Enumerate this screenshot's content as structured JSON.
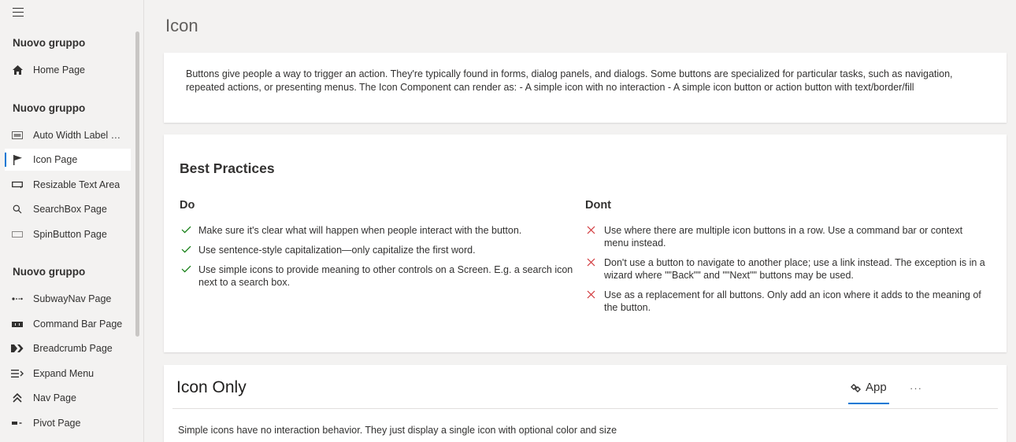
{
  "sidebar": {
    "groups": [
      {
        "title": "Nuovo gruppo",
        "items": [
          {
            "label": "Home Page",
            "icon": "home-icon"
          }
        ]
      },
      {
        "title": "Nuovo gruppo",
        "items": [
          {
            "label": "Auto Width Label Page",
            "icon": "label-icon"
          },
          {
            "label": "Icon Page",
            "icon": "flag-icon",
            "selected": true
          },
          {
            "label": "Resizable Text Area",
            "icon": "text-area-icon"
          },
          {
            "label": "SearchBox Page",
            "icon": "search-icon"
          },
          {
            "label": "SpinButton Page",
            "icon": "spin-button-icon"
          }
        ]
      },
      {
        "title": "Nuovo gruppo",
        "items": [
          {
            "label": "SubwayNav Page",
            "icon": "subway-nav-icon"
          },
          {
            "label": "Command Bar Page",
            "icon": "command-bar-icon"
          },
          {
            "label": "Breadcrumb Page",
            "icon": "breadcrumb-icon"
          },
          {
            "label": "Expand Menu",
            "icon": "expand-menu-icon"
          },
          {
            "label": "Nav Page",
            "icon": "nav-icon"
          },
          {
            "label": "Pivot Page",
            "icon": "pivot-icon"
          }
        ]
      }
    ]
  },
  "main": {
    "title": "Icon",
    "description": "Buttons give people a way to trigger an action. They're typically found in forms, dialog panels, and dialogs. Some buttons are specialized for particular tasks, such as navigation, repeated actions, or presenting menus. The Icon Component can render as: - A simple icon with no interaction - A simple icon button or action button with text/border/fill",
    "best_practices": {
      "title": "Best Practices",
      "do_title": "Do",
      "do": [
        "Make sure it's clear what will happen when people interact with the button.",
        "Use sentence-style capitalization—only capitalize the first word.",
        "Use simple icons to provide meaning to other controls on a Screen. E.g. a search icon next to a search box."
      ],
      "dont_title": "Dont",
      "dont": [
        "Use where there are multiple icon buttons in a row. Use a command bar or context menu instead.",
        "Don't use a button to navigate to another place; use a link instead. The exception is in a wizard where \"\"Back\"\" and \"\"Next\"\" buttons may be used.",
        "Use as a replacement for all buttons. Only add an icon where it adds to the meaning of the button."
      ]
    },
    "icon_only": {
      "title": "Icon Only",
      "tab_label": "App",
      "more_label": "···",
      "description": "Simple icons have no interaction behavior. They just display a single icon with optional color and size"
    }
  },
  "colors": {
    "accent": "#0078d4",
    "check": "#107c10",
    "cross": "#d13438"
  }
}
